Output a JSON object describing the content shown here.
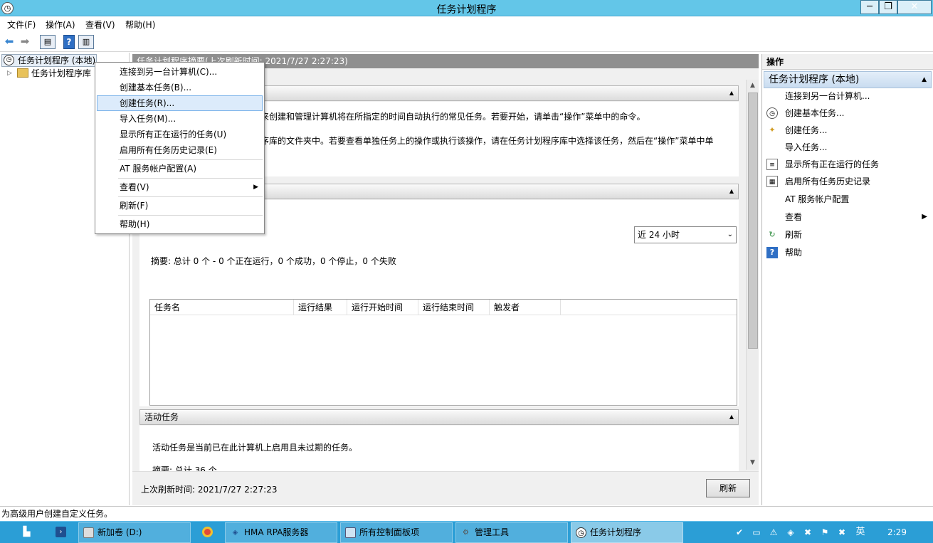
{
  "window": {
    "title": "任务计划程序",
    "minimize": "─",
    "maximize": "❐",
    "close": "✕"
  },
  "menubar": [
    "文件(F)",
    "操作(A)",
    "查看(V)",
    "帮助(H)"
  ],
  "tree": {
    "root": "任务计划程序 (本地)",
    "library": "任务计划程序库"
  },
  "center": {
    "header": "任务计划程序摘要(上次刷新时间: 2021/7/27 2:27:23)",
    "overview_line1": "来创建和管理计算机将在所指定的时间自动执行的常见任务。若要开始，请单击“操作”菜单中的命令。",
    "overview_line2": "序库的文件夹中。若要查看单独任务上的操作或执行该操作，请在任务计划程序库中选择该任务，然后在“操作”菜单中单",
    "status_filter": "近 24 小时",
    "summary": "摘要: 总计 0 个 - 0 个正在运行，0 个成功，0 个停止，0 个失败",
    "grid_columns": [
      "任务名",
      "运行结果",
      "运行开始时间",
      "运行结束时间",
      "触发者"
    ],
    "active_title": "活动任务",
    "active_desc": "活动任务是当前已在此计算机上启用且未过期的任务。",
    "active_summary": "摘要: 总计 36 个",
    "last_refresh": "上次刷新时间: 2021/7/27 2:27:23",
    "refresh_button": "刷新"
  },
  "actions": {
    "header": "操作",
    "section": "任务计划程序 (本地)",
    "items": [
      {
        "label": "连接到另一台计算机...",
        "icon": ""
      },
      {
        "label": "创建基本任务...",
        "icon": "clock-icon"
      },
      {
        "label": "创建任务...",
        "icon": "task-icon"
      },
      {
        "label": "导入任务...",
        "icon": ""
      },
      {
        "label": "显示所有正在运行的任务",
        "icon": "list-icon"
      },
      {
        "label": "启用所有任务历史记录",
        "icon": "history-icon"
      },
      {
        "label": "AT 服务帐户配置",
        "icon": ""
      },
      {
        "label": "查看",
        "icon": ""
      },
      {
        "label": "刷新",
        "icon": "refresh-icon"
      },
      {
        "label": "帮助",
        "icon": "help-icon"
      }
    ]
  },
  "context_menu": {
    "items": [
      "连接到另一台计算机(C)...",
      "创建基本任务(B)...",
      "创建任务(R)...",
      "导入任务(M)...",
      "显示所有正在运行的任务(U)",
      "启用所有任务历史记录(E)",
      "AT 服务帐户配置(A)",
      "查看(V)",
      "刷新(F)",
      "帮助(H)"
    ],
    "highlighted": "创建任务(R)..."
  },
  "statusbar": "为高级用户创建自定义任务。",
  "taskbar": {
    "buttons": [
      "新加卷 (D:)",
      "HMA RPA服务器",
      "所有控制面板项",
      "管理工具",
      "任务计划程序"
    ],
    "ime": "英",
    "clock": "2:29"
  },
  "colors": {
    "titlebar": "#63c6e8",
    "taskbar": "#2b9ed6",
    "highlight": "#dcebfb"
  }
}
